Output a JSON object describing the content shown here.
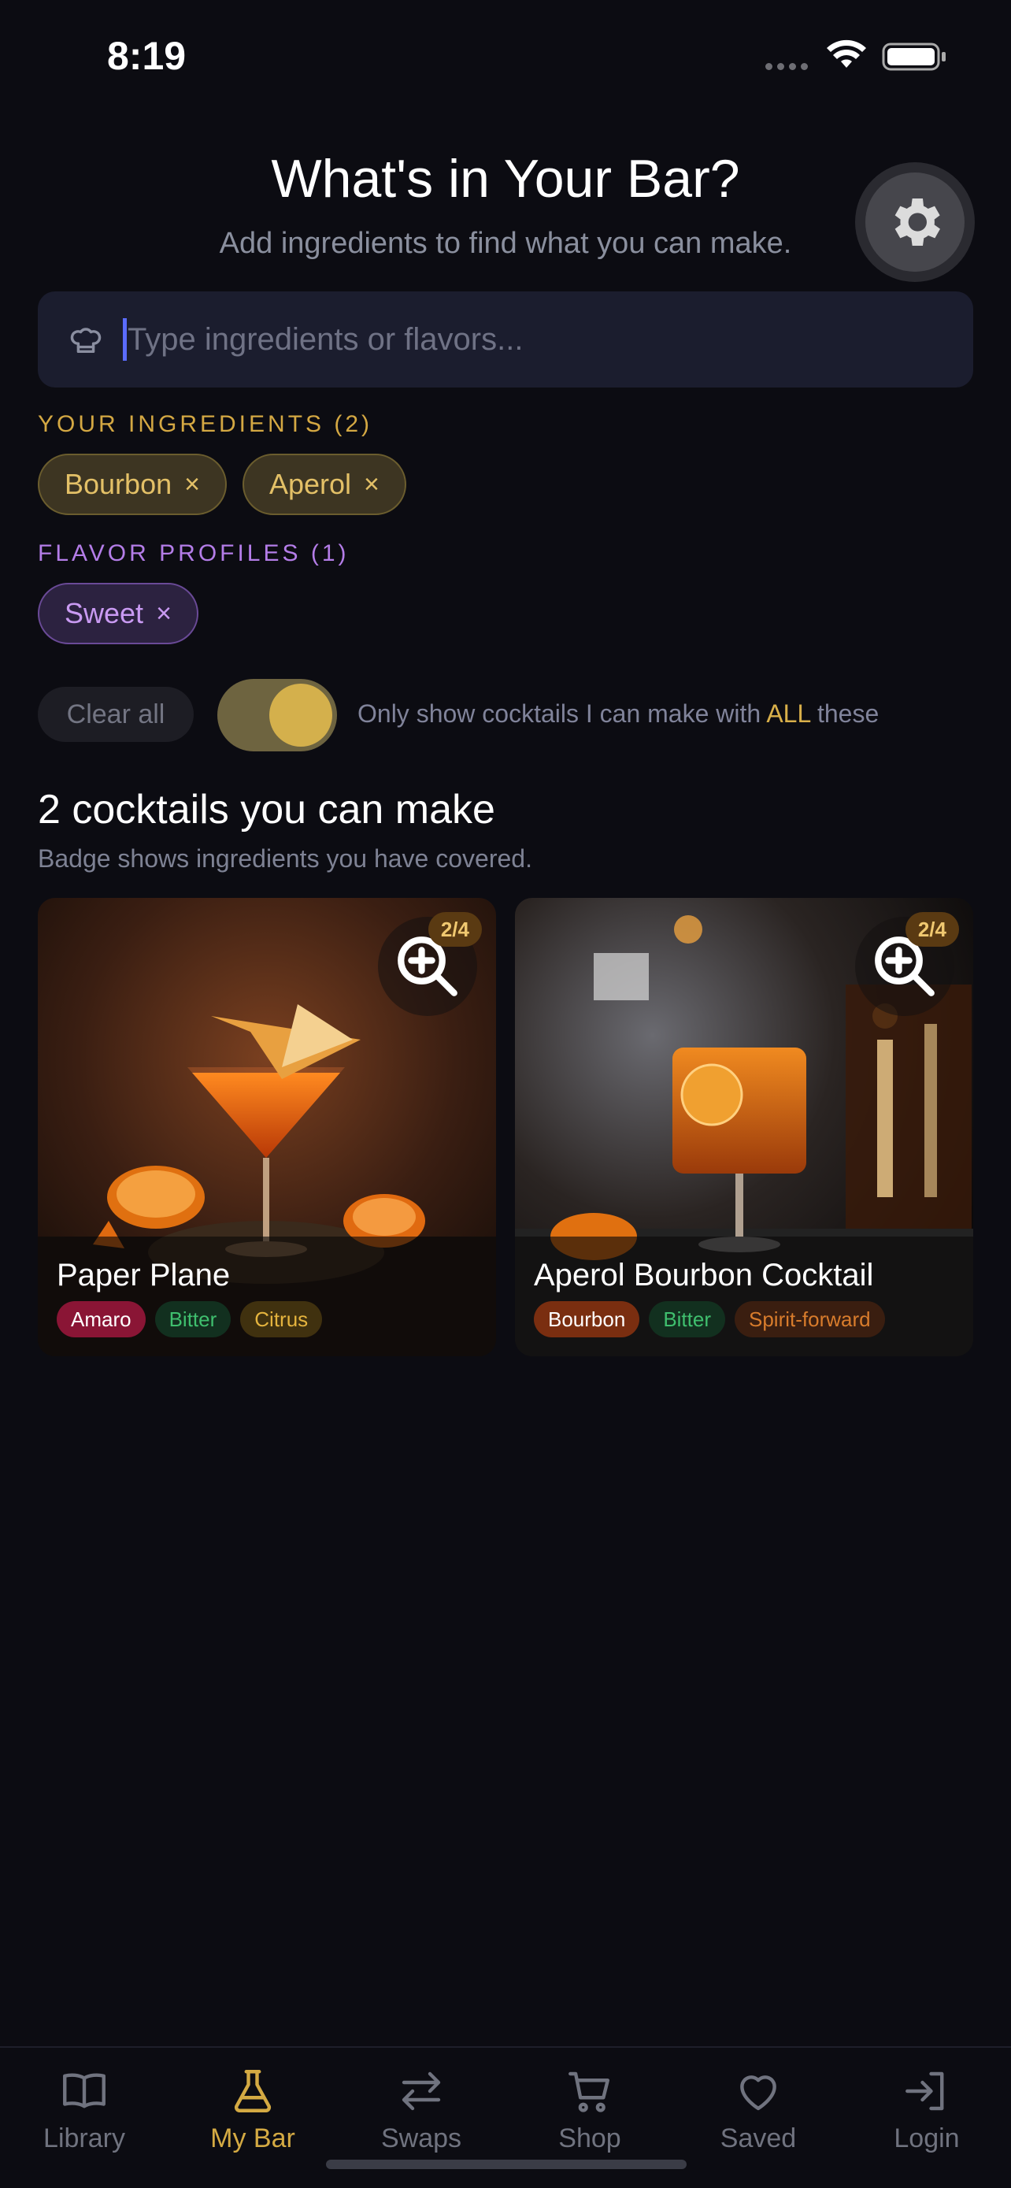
{
  "status_bar": {
    "time": "8:19",
    "icons": [
      "signal-icon",
      "wifi-icon",
      "battery-icon"
    ]
  },
  "header": {
    "title": "What's in Your Bar?",
    "subtitle": "Add ingredients to find what you can make.",
    "settings_icon": "gear-icon"
  },
  "search": {
    "placeholder": "Type ingredients or flavors...",
    "value": "",
    "icon": "chef-hat-icon"
  },
  "ingredients": {
    "label": "YOUR INGREDIENTS (2)",
    "items": [
      {
        "label": "Bourbon",
        "remove": "×"
      },
      {
        "label": "Aperol",
        "remove": "×"
      }
    ]
  },
  "flavors": {
    "label": "FLAVOR PROFILES (1)",
    "items": [
      {
        "label": "Sweet",
        "remove": "×"
      }
    ]
  },
  "filters": {
    "clear_all": "Clear all",
    "toggle_on": true,
    "toggle_text_before": "Only show cocktails I can make with ",
    "toggle_text_emphasis": "ALL",
    "toggle_text_after": " these"
  },
  "results": {
    "title": "2 cocktails you can make",
    "subtitle": "Badge shows ingredients you have covered.",
    "cards": [
      {
        "name": "Paper Plane",
        "badge": "2/4",
        "tags": [
          "Amaro",
          "Bitter",
          "Citrus"
        ]
      },
      {
        "name": "Aperol Bourbon Cocktail",
        "badge": "2/4",
        "tags": [
          "Bourbon",
          "Bitter",
          "Spirit-forward"
        ]
      }
    ]
  },
  "tab_bar": {
    "active": "My Bar",
    "tabs": [
      {
        "label": "Library",
        "icon": "book-icon"
      },
      {
        "label": "My Bar",
        "icon": "flask-icon"
      },
      {
        "label": "Swaps",
        "icon": "swap-arrows-icon"
      },
      {
        "label": "Shop",
        "icon": "cart-icon"
      },
      {
        "label": "Saved",
        "icon": "heart-icon"
      },
      {
        "label": "Login",
        "icon": "login-icon"
      }
    ]
  },
  "colors": {
    "background": "#0c0c12",
    "accent_gold": "#d4aa43",
    "accent_purple": "#b47de8",
    "search_bg": "#1b1d2e"
  }
}
